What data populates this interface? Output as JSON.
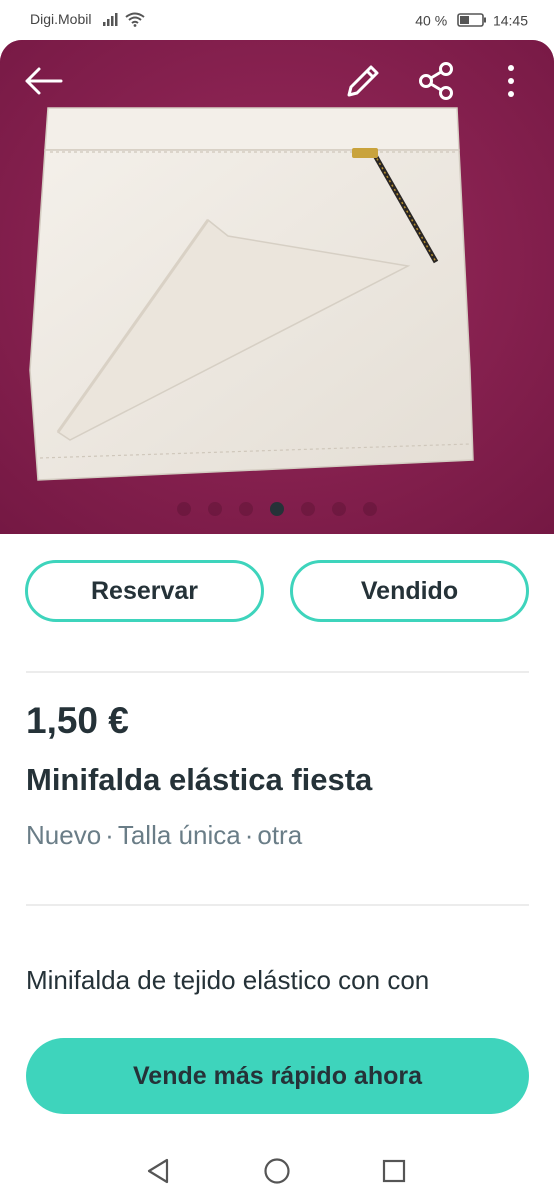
{
  "status_bar": {
    "carrier": "Digi.Mobil",
    "battery": "40 %",
    "time": "14:45",
    "icons": [
      "signal-icon",
      "wifi-icon",
      "battery-icon"
    ]
  },
  "hero": {
    "icons": [
      "back-arrow-icon",
      "pencil-icon",
      "share-icon",
      "more-vert-icon"
    ],
    "background_color": "#8a2150",
    "dots_total": 7,
    "active_dot": 4
  },
  "actions": {
    "reserve_label": "Reservar",
    "sold_label": "Vendido",
    "accent": "#3ed4bc"
  },
  "product": {
    "price": "1,50 €",
    "title": "Minifalda elástica fiesta",
    "condition": "Nuevo",
    "size": "Talla única",
    "brand": "otra",
    "separator": "·",
    "description": "Minifalda de tejido elástico con con"
  },
  "cta": {
    "label": "Vende más rápido ahora"
  },
  "navbar": {
    "icons": [
      "nav-back-icon",
      "nav-home-icon",
      "nav-recents-icon"
    ]
  }
}
